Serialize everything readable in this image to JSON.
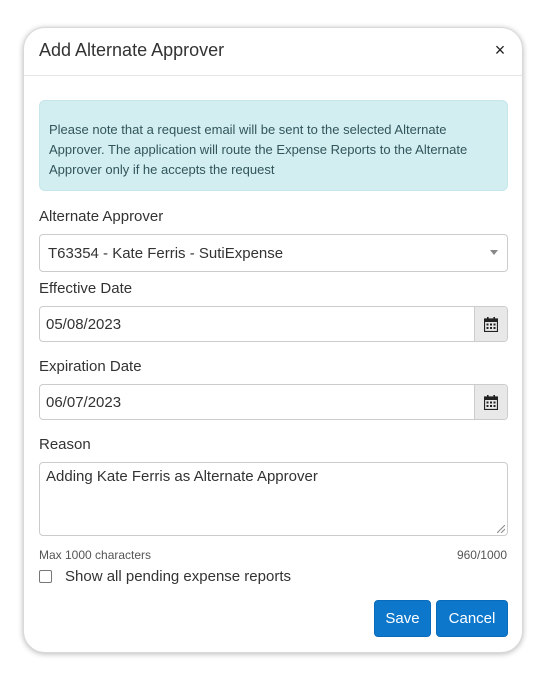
{
  "dialog": {
    "title": "Add Alternate Approver",
    "close_symbol": "×"
  },
  "alert": {
    "message": "Please note that a request email will be sent to the selected Alternate Approver. The application will route the Expense Reports to the Alternate Approver only if he accepts the request"
  },
  "approver": {
    "label": "Alternate Approver",
    "selected": "T63354 - Kate Ferris - SutiExpense"
  },
  "effective_date": {
    "label": "Effective Date",
    "value": "05/08/2023"
  },
  "expiration_date": {
    "label": "Expiration Date",
    "value": "06/07/2023"
  },
  "reason": {
    "label": "Reason",
    "value": "Adding Kate Ferris as Alternate Approver",
    "max_text": "Max 1000 characters",
    "counter": "960/1000"
  },
  "pending": {
    "label": "Show all pending expense reports",
    "checked": false
  },
  "buttons": {
    "save": "Save",
    "cancel": "Cancel"
  },
  "colors": {
    "primary": "#0d77cc",
    "alert_bg": "#d2eef1",
    "alert_text": "#31555b"
  },
  "icons": {
    "close": "close-icon",
    "calendar": "calendar-icon",
    "dropdown": "chevron-down-icon",
    "resize": "resize-grip-icon"
  }
}
